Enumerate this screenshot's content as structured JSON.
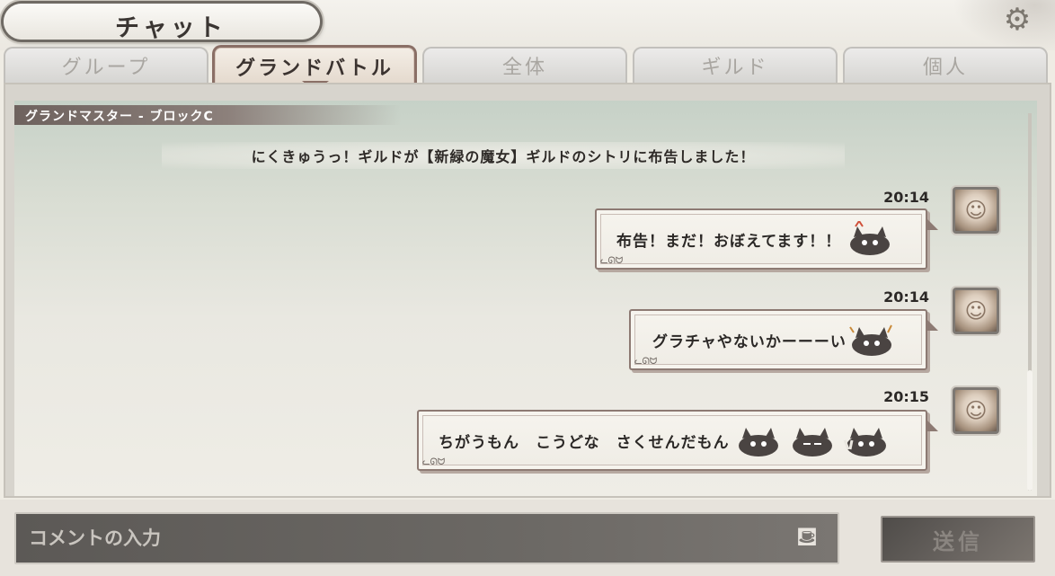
{
  "header": {
    "title": "チャット",
    "settings_icon": "gear-icon"
  },
  "tabs": [
    {
      "label": "グループ",
      "active": false
    },
    {
      "label": "グランドバトル",
      "active": true
    },
    {
      "label": "全体",
      "active": false
    },
    {
      "label": "ギルド",
      "active": false
    },
    {
      "label": "個人",
      "active": false
    }
  ],
  "chat": {
    "section_title": "グランドマスター - ブロックC",
    "system_message": "にくきゅうっ！ギルドが【新緑の魔女】ギルドのシトリに布告しました！",
    "messages": [
      {
        "time": "20:14",
        "text": "布告！まだ！おぼえてます！！",
        "stamps": [
          "cat-stamp-angry"
        ]
      },
      {
        "time": "20:14",
        "text": "グラチャやないかーーーい",
        "stamps": [
          "cat-stamp-surprised"
        ]
      },
      {
        "time": "20:15",
        "text": "ちがうもん　こうどな　さくせんだもん",
        "stamps": [
          "cat-stamp-sad",
          "cat-stamp-smug",
          "cat-stamp-peace"
        ]
      }
    ]
  },
  "input": {
    "placeholder": "コメントの入力",
    "send_label": "送信",
    "stamp_icon": "stamp-icon"
  },
  "colors": {
    "active_tab_border": "#8a6f66",
    "section_header": "#6e625e",
    "bubble_border": "#8d7a73",
    "input_background": "#5c5956"
  }
}
